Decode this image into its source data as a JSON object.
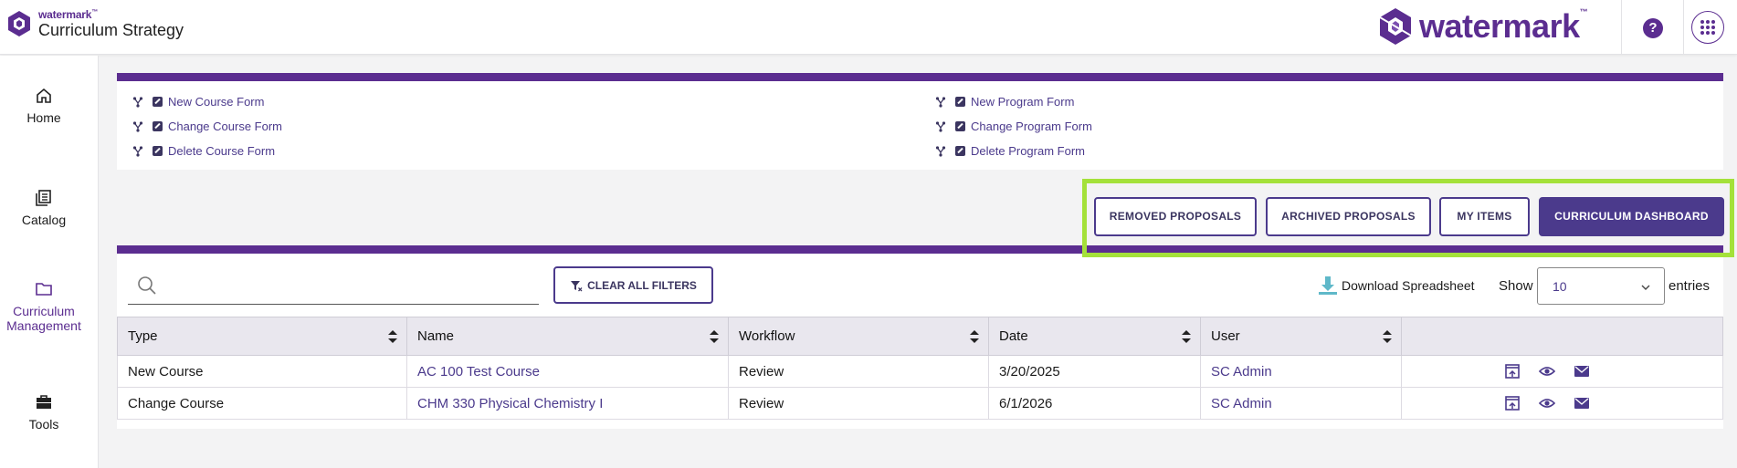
{
  "header": {
    "brand_small": "watermark",
    "brand_tm": "™",
    "product_name": "Curriculum Strategy",
    "logo_word": "watermark",
    "logo_tm": "™",
    "help_label": "?"
  },
  "sidebar": {
    "items": [
      {
        "label": "Home",
        "icon": "home-icon"
      },
      {
        "label": "Catalog",
        "icon": "catalog-icon"
      },
      {
        "label": "Curriculum Management",
        "icon": "folder-icon",
        "active": true
      },
      {
        "label": "Tools",
        "icon": "toolbox-icon"
      }
    ]
  },
  "forms": {
    "left": [
      "New Course Form",
      "Change Course Form",
      "Delete Course Form"
    ],
    "right": [
      "New Program Form",
      "Change Program Form",
      "Delete Program Form"
    ]
  },
  "buttons": {
    "removed": "REMOVED PROPOSALS",
    "archived": "ARCHIVED PROPOSALS",
    "my_items": "MY ITEMS",
    "dashboard": "CURRICULUM DASHBOARD"
  },
  "toolbar": {
    "search_placeholder": "",
    "clear_filters": "CLEAR ALL FILTERS",
    "download": "Download Spreadsheet",
    "show": "Show",
    "entries_value": "10",
    "entries": "entries"
  },
  "table": {
    "columns": [
      "Type",
      "Name",
      "Workflow",
      "Date",
      "User"
    ],
    "rows": [
      {
        "type": "New Course",
        "name": "AC 100 Test Course",
        "workflow": "Review",
        "date": "3/20/2025",
        "user": "SC Admin"
      },
      {
        "type": "Change Course",
        "name": "CHM 330 Physical Chemistry I",
        "workflow": "Review",
        "date": "6/1/2026",
        "user": "SC Admin"
      }
    ]
  },
  "colors": {
    "brand_purple": "#5b2d90",
    "button_purple": "#4b3a8c",
    "highlight_green": "#a4e13a"
  }
}
